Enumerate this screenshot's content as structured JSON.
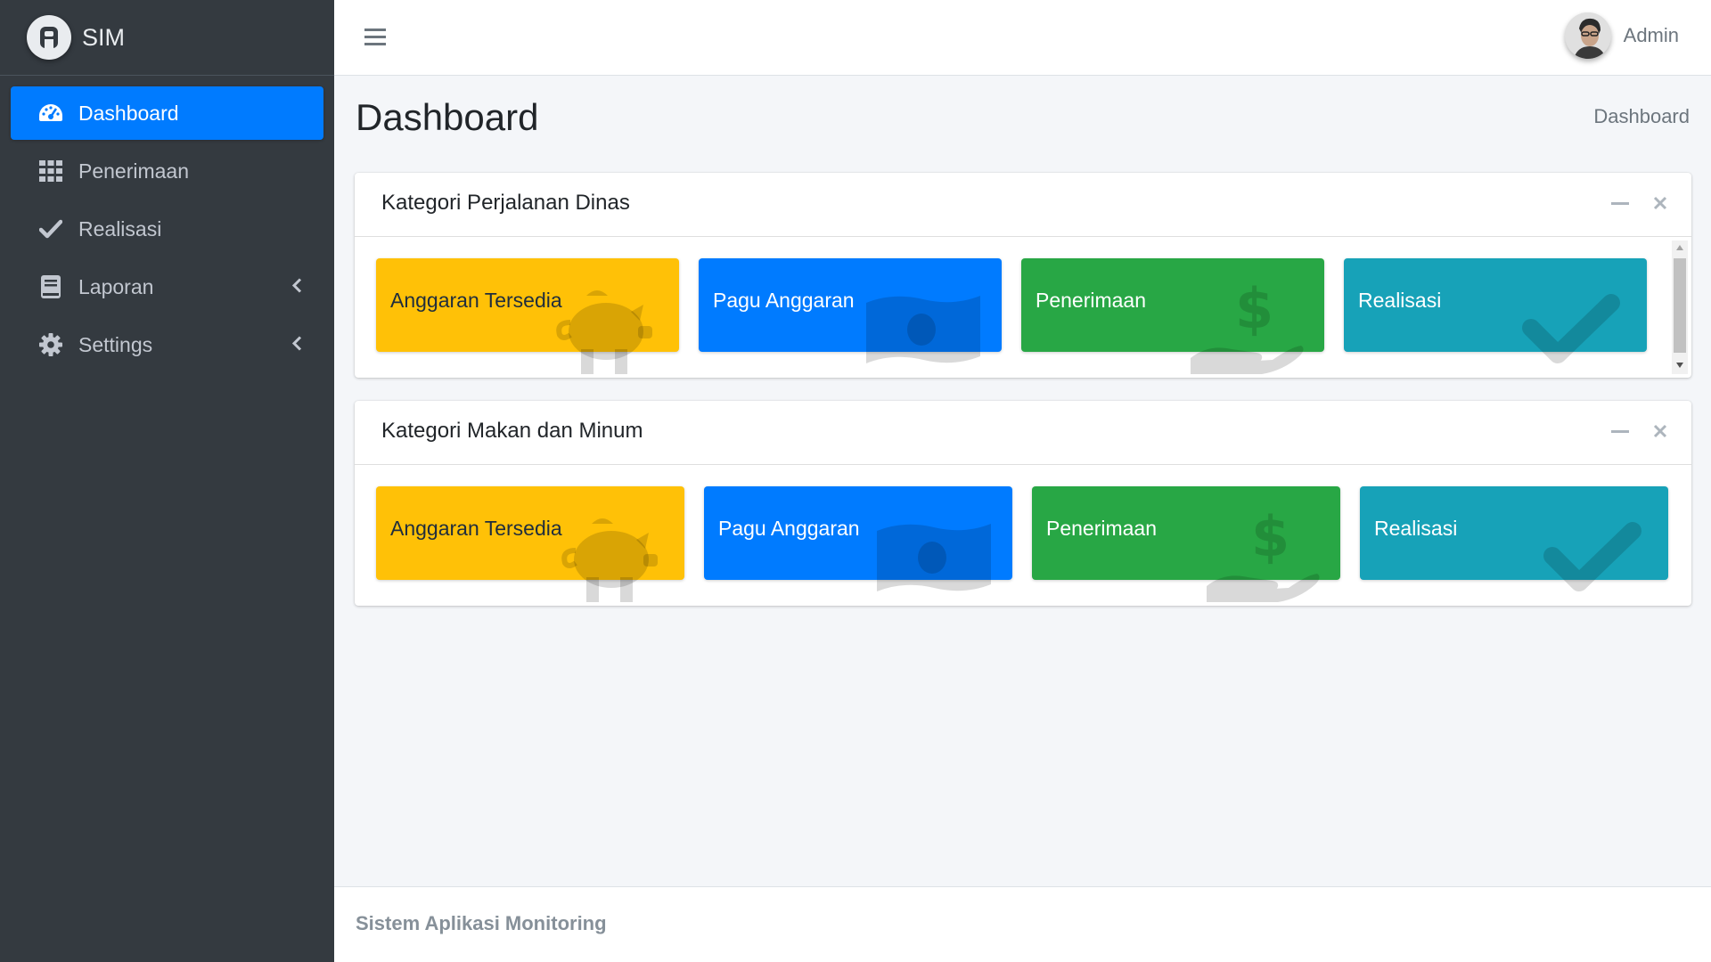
{
  "brand": {
    "name": "SIM"
  },
  "sidebar": {
    "items": [
      {
        "label": "Dashboard",
        "icon": "tachometer-icon",
        "active": true
      },
      {
        "label": "Penerimaan",
        "icon": "grid-icon"
      },
      {
        "label": "Realisasi",
        "icon": "check-icon"
      },
      {
        "label": "Laporan",
        "icon": "book-icon",
        "has_submenu": true
      },
      {
        "label": "Settings",
        "icon": "gear-icon",
        "has_submenu": true
      }
    ]
  },
  "topbar": {
    "user_name": "Admin"
  },
  "page": {
    "title": "Dashboard",
    "breadcrumb": "Dashboard"
  },
  "cards": [
    {
      "title": "Kategori Perjalanan Dinas",
      "boxes": [
        {
          "label": "Anggaran Tersedia",
          "color": "#ffc107",
          "icon": "piggy-bank-icon"
        },
        {
          "label": "Pagu Anggaran",
          "color": "#007bff",
          "icon": "money-bill-icon"
        },
        {
          "label": "Penerimaan",
          "color": "#28a745",
          "icon": "hand-holding-dollar-icon"
        },
        {
          "label": "Realisasi",
          "color": "#17a2b8",
          "icon": "check-icon"
        }
      ]
    },
    {
      "title": "Kategori Makan dan Minum",
      "boxes": [
        {
          "label": "Anggaran Tersedia",
          "color": "#ffc107",
          "icon": "piggy-bank-icon"
        },
        {
          "label": "Pagu Anggaran",
          "color": "#007bff",
          "icon": "money-bill-icon"
        },
        {
          "label": "Penerimaan",
          "color": "#28a745",
          "icon": "hand-holding-dollar-icon"
        },
        {
          "label": "Realisasi",
          "color": "#17a2b8",
          "icon": "check-icon"
        }
      ]
    }
  ],
  "footer": {
    "text": "Sistem Aplikasi Monitoring"
  }
}
